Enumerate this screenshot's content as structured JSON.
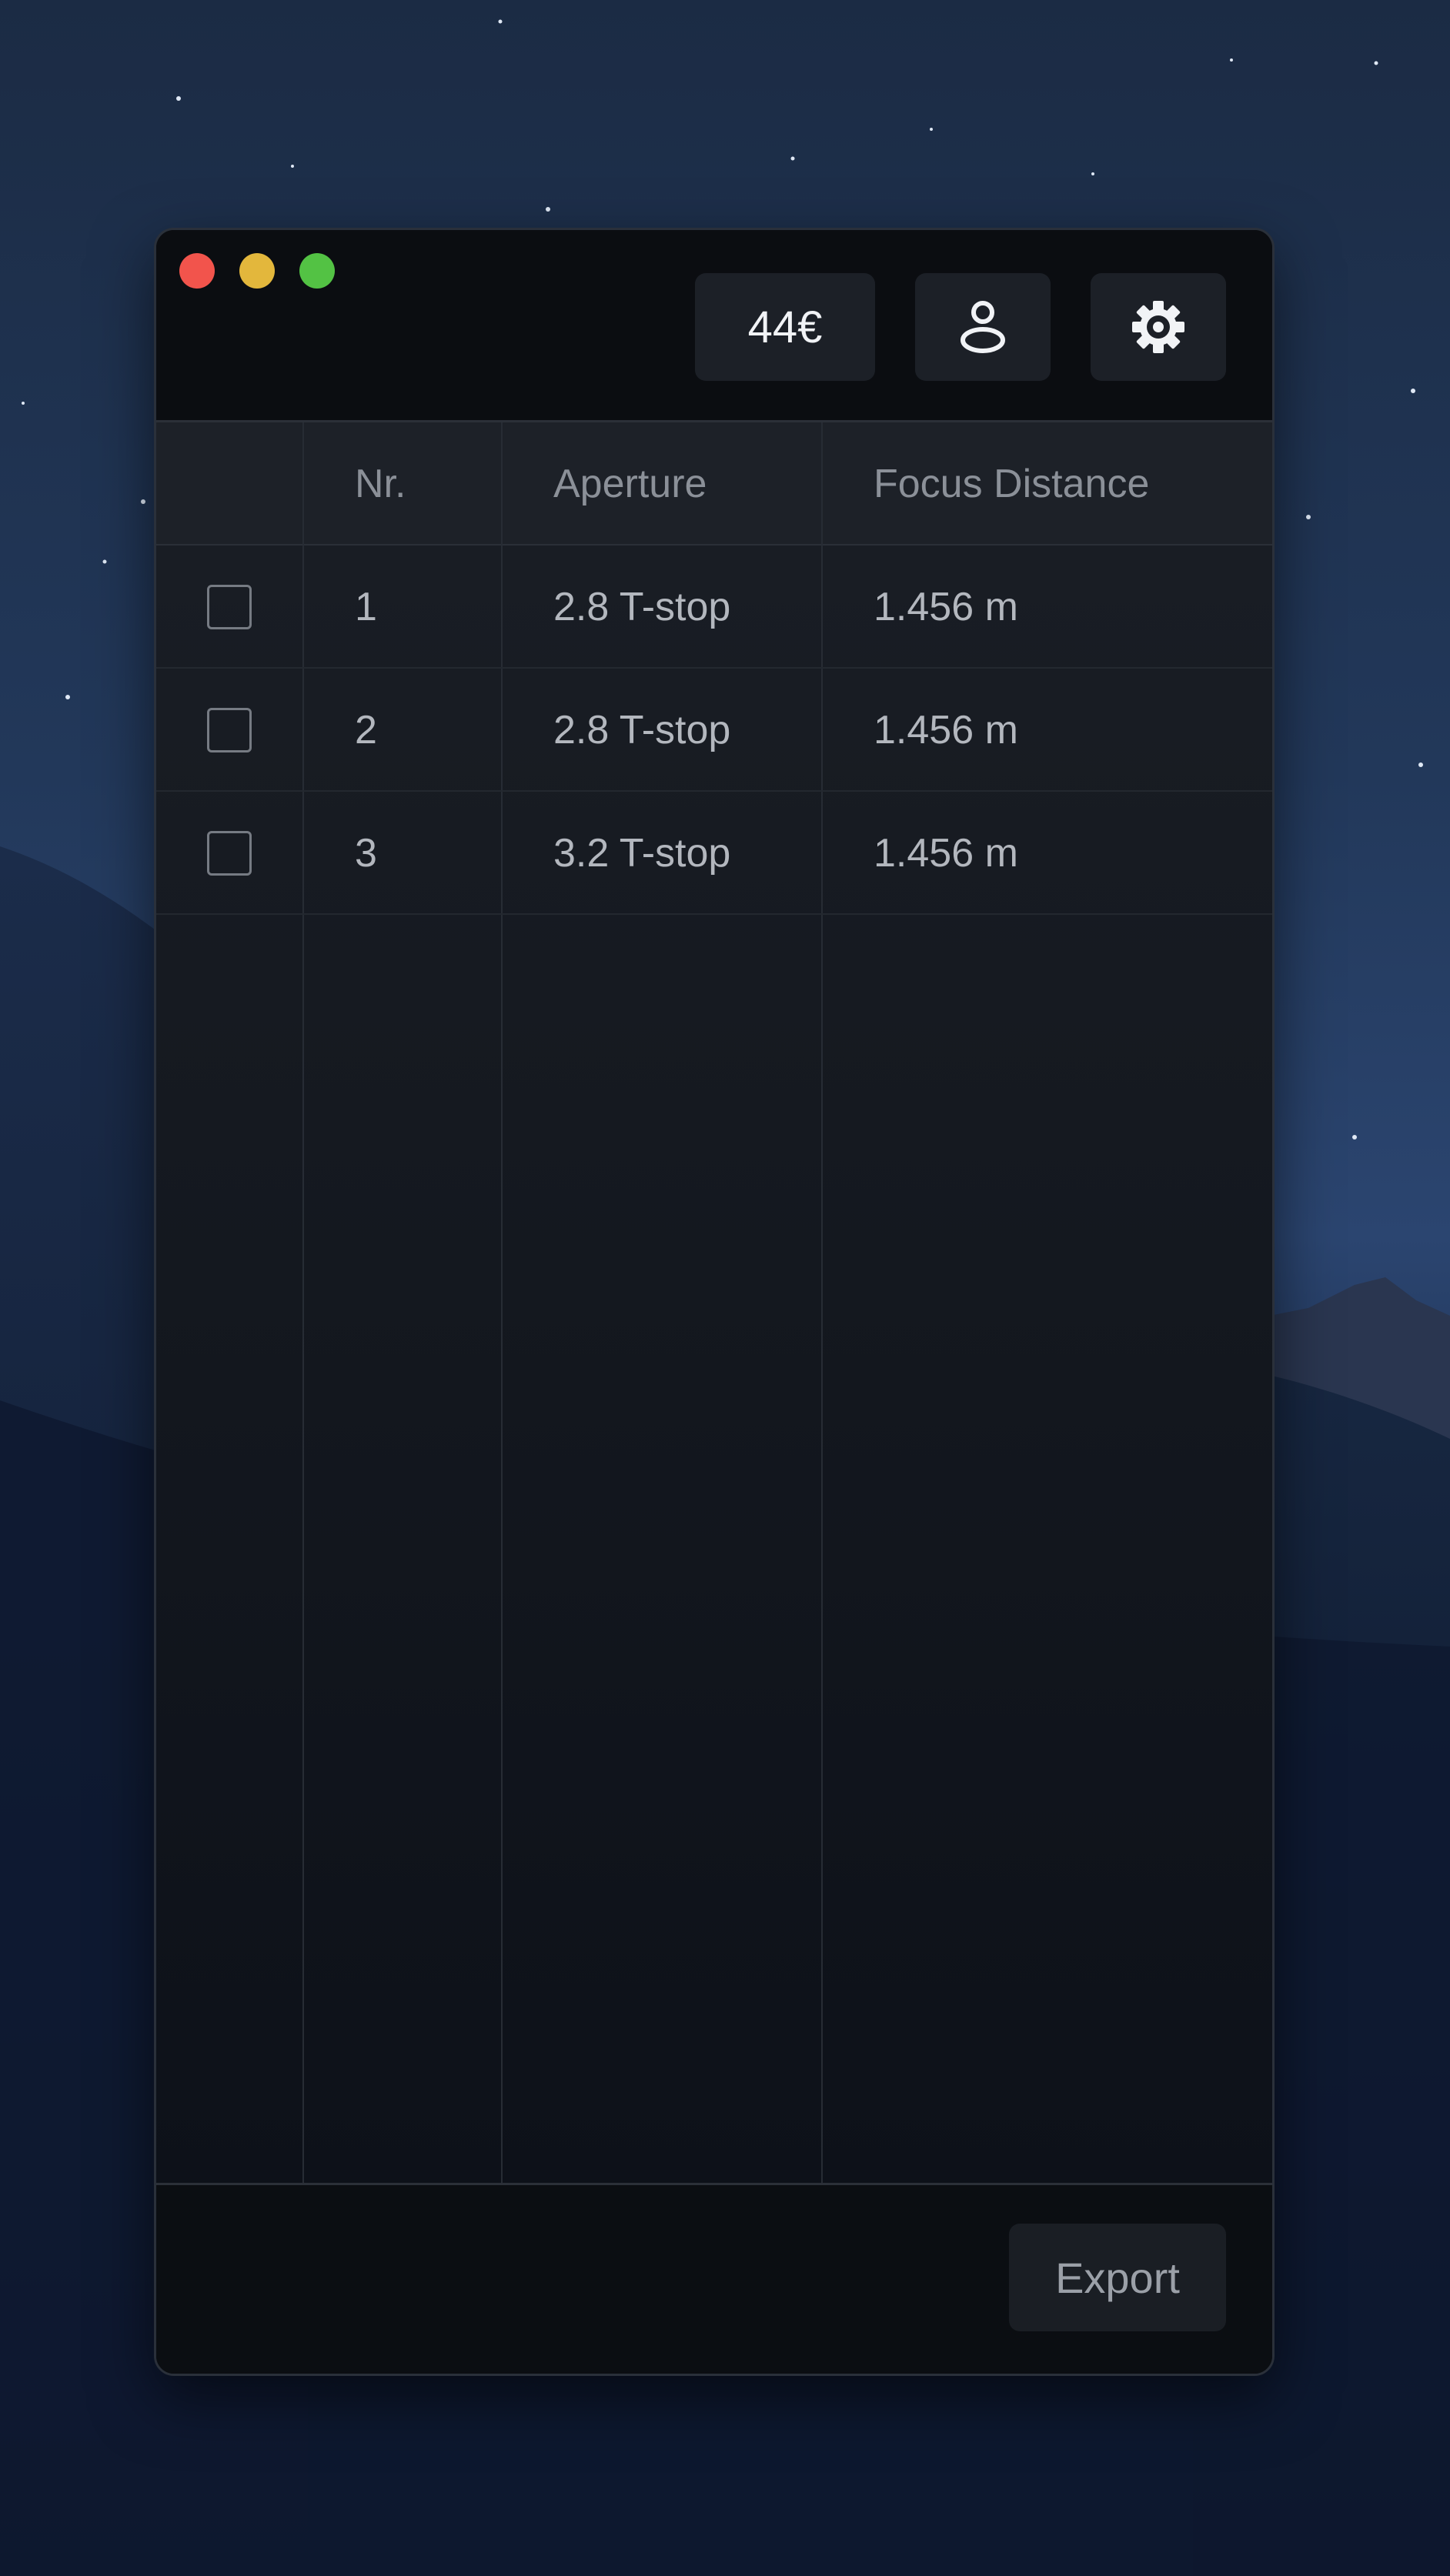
{
  "window": {
    "traffic_lights": [
      "close",
      "minimize",
      "maximize"
    ]
  },
  "toolbar": {
    "price_label": "44€",
    "account_icon": "person-icon",
    "settings_icon": "gear-icon"
  },
  "table": {
    "columns": [
      "",
      "Nr.",
      "Aperture",
      "Focus Distance"
    ],
    "rows": [
      {
        "checked": false,
        "nr": "1",
        "aperture": "2.8 T-stop",
        "focus": "1.456 m"
      },
      {
        "checked": false,
        "nr": "2",
        "aperture": "2.8 T-stop",
        "focus": "1.456 m"
      },
      {
        "checked": false,
        "nr": "3",
        "aperture": "3.2 T-stop",
        "focus": "1.456 m"
      }
    ]
  },
  "footer": {
    "export_label": "Export"
  },
  "colors": {
    "close": "#f2544c",
    "minimize": "#e3b73c",
    "maximize": "#53c244"
  }
}
